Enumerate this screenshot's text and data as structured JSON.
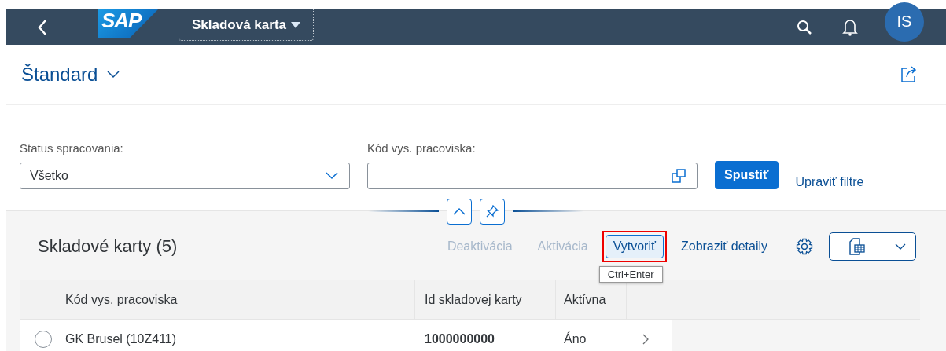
{
  "shell": {
    "logo": "SAP",
    "title": "Skladová karta",
    "avatar": "IS"
  },
  "variant": {
    "label": "Štandard"
  },
  "filters": [
    {
      "label": "Status spracovania:",
      "value": "Všetko",
      "kind": "select"
    },
    {
      "label": "Kód vys. pracoviska:",
      "kind": "valuehelp"
    }
  ],
  "go_button": "Spustiť",
  "adapt_filters": "Upraviť filtre",
  "table": {
    "title": "Skladové karty (5)",
    "actions": [
      {
        "label": "Deaktivácia",
        "disabled": true,
        "highlighted": false
      },
      {
        "label": "Aktivácia",
        "disabled": true,
        "highlighted": false
      },
      {
        "label": "Vytvoriť",
        "disabled": false,
        "highlighted": true
      },
      {
        "label": "Zobraziť detaily",
        "disabled": false,
        "highlighted": false
      }
    ],
    "tooltip": "Ctrl+Enter",
    "columns": [
      "Kód vys. pracoviska",
      "Id skladovej karty",
      "Aktívna"
    ],
    "rows": [
      {
        "selected": false,
        "cells": [
          "GK Brusel (10Z411)",
          "1000000000",
          "Áno"
        ]
      }
    ]
  }
}
